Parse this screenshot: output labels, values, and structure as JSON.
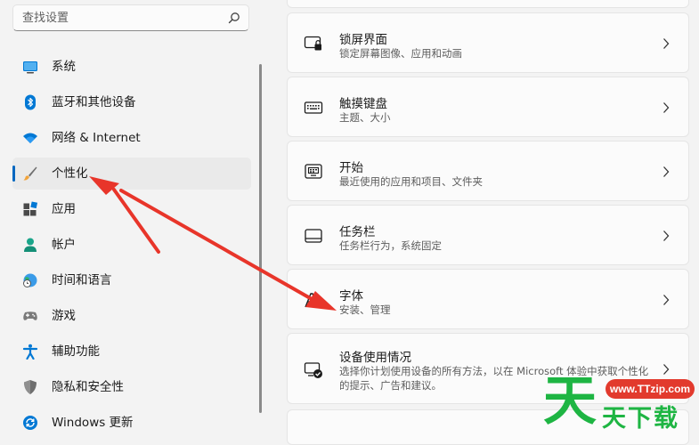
{
  "search": {
    "placeholder": "查找设置"
  },
  "sidebar": {
    "items": [
      {
        "label": "系统",
        "icon": "monitor-icon"
      },
      {
        "label": "蓝牙和其他设备",
        "icon": "bluetooth-icon"
      },
      {
        "label": "网络 & Internet",
        "icon": "wifi-icon"
      },
      {
        "label": "个性化",
        "icon": "brush-icon",
        "active": true
      },
      {
        "label": "应用",
        "icon": "apps-icon"
      },
      {
        "label": "帐户",
        "icon": "person-icon"
      },
      {
        "label": "时间和语言",
        "icon": "globe-clock-icon"
      },
      {
        "label": "游戏",
        "icon": "gamepad-icon"
      },
      {
        "label": "辅助功能",
        "icon": "accessibility-icon"
      },
      {
        "label": "隐私和安全性",
        "icon": "shield-icon"
      },
      {
        "label": "Windows 更新",
        "icon": "update-icon"
      }
    ]
  },
  "cards": [
    {
      "title": "锁屏界面",
      "subtitle": "锁定屏幕图像、应用和动画",
      "icon": "lock-screen-icon"
    },
    {
      "title": "触摸键盘",
      "subtitle": "主题、大小",
      "icon": "keyboard-icon"
    },
    {
      "title": "开始",
      "subtitle": "最近使用的应用和项目、文件夹",
      "icon": "start-icon"
    },
    {
      "title": "任务栏",
      "subtitle": "任务栏行为，系统固定",
      "icon": "taskbar-icon"
    },
    {
      "title": "字体",
      "subtitle": "安装、管理",
      "icon": "font-icon"
    },
    {
      "title": "设备使用情况",
      "subtitle": "选择你计划使用设备的所有方法，以在 Microsoft 体验中获取个性化的提示、广告和建议。",
      "icon": "device-usage-icon"
    }
  ],
  "watermark": {
    "url": "www.TTzip.com",
    "big": "天",
    "text": "天下载"
  },
  "colors": {
    "accent": "#0067c0",
    "arrow": "#e8352a",
    "watermark_green": "#1eb543",
    "watermark_red": "#e23a2d"
  }
}
